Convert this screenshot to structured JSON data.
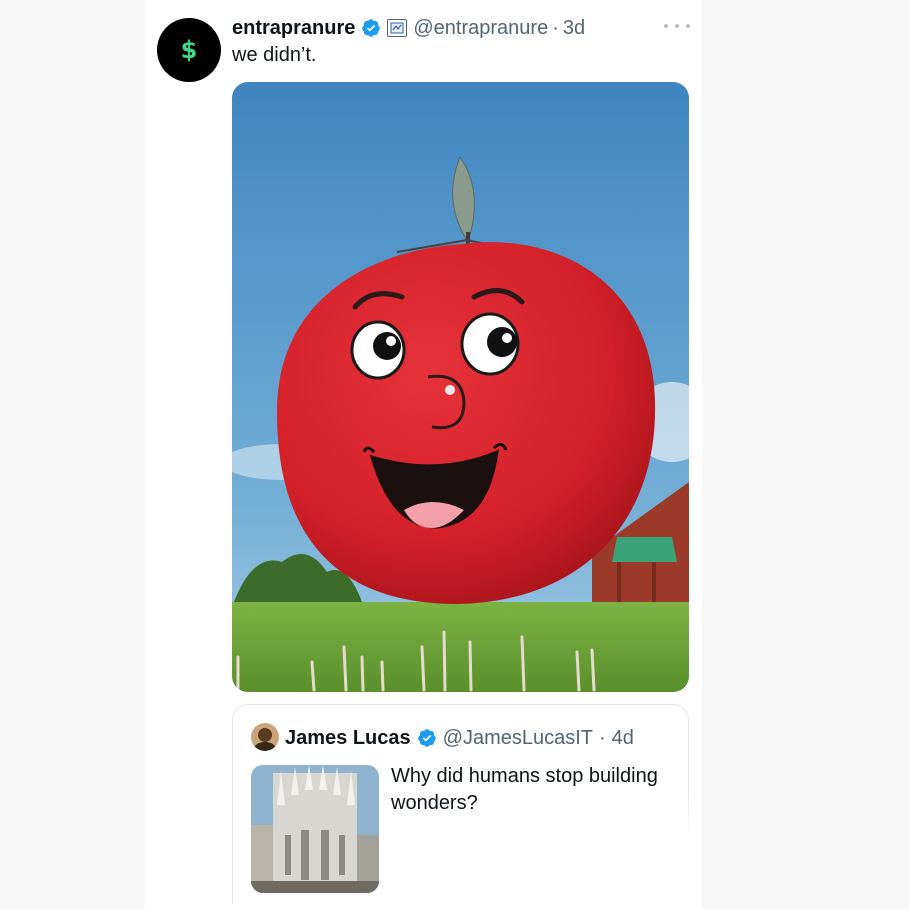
{
  "tweet": {
    "author_name": "entrapranure",
    "handle": "@entrapranure",
    "separator": "·",
    "time": "3d",
    "text": "we didn’t.",
    "avatar_glyph": "$",
    "verified_color": "#1d9bf0"
  },
  "quote": {
    "author_name": "James Lucas",
    "handle": "@JamesLucasIT",
    "separator": "·",
    "time": "4d",
    "text": "Why did humans stop building wonders?"
  },
  "icons": {
    "verified": "verified-badge-icon",
    "org": "affiliate-badge-icon",
    "more": "more-dots-icon"
  },
  "colors": {
    "text_primary": "#0f1419",
    "text_secondary": "#536471",
    "apple_red": "#d7232b",
    "sky": "#4f93c7",
    "grass": "#6fa33a"
  }
}
